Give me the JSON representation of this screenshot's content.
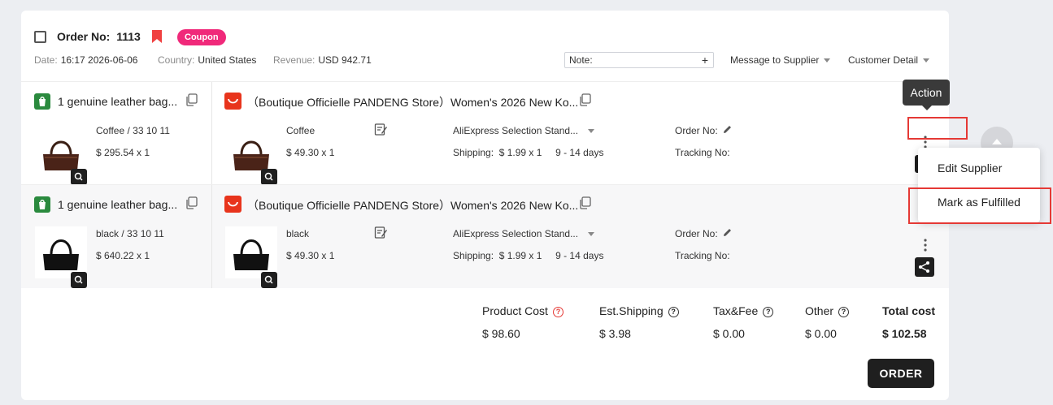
{
  "order": {
    "label": "Order No:",
    "number": "1113",
    "coupon": "Coupon",
    "date_label": "Date:",
    "date": "16:17 2026-06-06",
    "country_label": "Country:",
    "country": "United States",
    "revenue_label": "Revenue:",
    "revenue": "USD 942.71",
    "note_label": "Note:",
    "note_add": "+",
    "message_supplier": "Message to Supplier",
    "customer_detail": "Customer Detail"
  },
  "items": [
    {
      "product_title": "1 genuine leather bag...",
      "variant": "Coffee / 33 10 11",
      "price": "$ 295.54 x 1",
      "supplier_title": "（Boutique Officielle PANDENG Store）Women's 2026 New Ko...",
      "supplier_variant": "Coffee",
      "supplier_price": "$ 49.30 x 1",
      "shipping_method": "AliExpress Selection Stand...",
      "shipping": "Shipping:  $ 1.99 x 1     9 - 14 days",
      "order_no": "Order No:",
      "tracking_no": "Tracking No:"
    },
    {
      "product_title": "1 genuine leather bag...",
      "variant": "black / 33 10 11",
      "price": "$ 640.22 x 1",
      "supplier_title": "（Boutique Officielle PANDENG Store）Women's 2026 New Ko...",
      "supplier_variant": "black",
      "supplier_price": "$ 49.30 x 1",
      "shipping_method": "AliExpress Selection Stand...",
      "shipping": "Shipping:  $ 1.99 x 1     9 - 14 days",
      "order_no": "Order No:",
      "tracking_no": "Tracking No:"
    }
  ],
  "action": {
    "tooltip": "Action",
    "menu": [
      "Edit Supplier",
      "Mark as Fulfilled"
    ]
  },
  "costs": {
    "product_cost_label": "Product Cost",
    "product_cost": "$ 98.60",
    "shipping_label": "Est.Shipping",
    "shipping": "$ 3.98",
    "tax_label": "Tax&Fee",
    "tax": "$ 0.00",
    "other_label": "Other",
    "other": "$ 0.00",
    "total_label": "Total cost",
    "total": "$ 102.58"
  },
  "order_button": "ORDER",
  "colors": {
    "coupon": "#f0297a",
    "bookmark": "#f04040",
    "highlight": "#e53935",
    "aliexpress": "#e8341c",
    "shopify": "#2a8a3e"
  }
}
